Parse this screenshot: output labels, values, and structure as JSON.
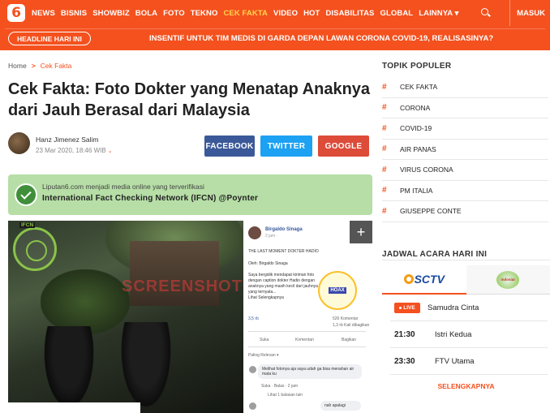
{
  "nav": {
    "logo": "6",
    "links": [
      "NEWS",
      "BISNIS",
      "SHOWBIZ",
      "BOLA",
      "FOTO",
      "TEKNO",
      "CEK FAKTA",
      "VIDEO",
      "HOT",
      "DISABILITAS",
      "GLOBAL",
      "LAINNYA ▾"
    ],
    "active_index": 6,
    "login": "MASUK"
  },
  "headline": {
    "badge": "HEADLINE HARI INI",
    "text": "INSENTIF UNTUK TIM MEDIS DI GARDA DEPAN LAWAN CORONA COVID-19, REALISASINYA?"
  },
  "breadcrumb": {
    "home": "Home",
    "separator": ">",
    "category": "Cek Fakta"
  },
  "article": {
    "title": "Cek Fakta: Foto Dokter yang Menatap Anaknya dari Jauh Berasal dari Malaysia",
    "author": "Hanz Jimenez Salim",
    "date": "23 Mar 2020, 18:46 WIB"
  },
  "share": {
    "facebook": "FACEBOOK",
    "twitter": "TWITTER",
    "google": "GOOGLE"
  },
  "factcheck": {
    "line1": "Liputan6.com menjadi media online yang terverifikasi",
    "line2": "International Fact Checking Network (IFCN) @Poynter"
  },
  "photo": {
    "ifcn_label": "IFCN",
    "watermark": "SCREENSHOT",
    "post": {
      "name": "Birgaldo Sinaga",
      "time": "2 jam · ",
      "heading": "THE LAST MOMENT DOKTER HADIO",
      "byline": "Oleh: Birgaldo Sinaga",
      "body": "Saya bergidik mendapat kiriman foto dengan caption dokter Hadio dengan anaknya yang masih kecil dari jauhnya yang ternyata...",
      "more": "Lihat Selengkapnya",
      "hoax_stamp": "HOAX",
      "reactions": "3,5 rb",
      "comments_count": "526 Komentar",
      "shares_count": "1,3 rb Kali dibagikan",
      "actions": [
        "Suka",
        "Komentari",
        "Bagikan"
      ],
      "relevance": "Paling Relevan ▾",
      "comment1": "Melihat fotonya aja saya udah ga bisa menahan air mata ku",
      "comment1_meta": "Suka · Balas · 2 jam",
      "replies": "Lihat 1 balasan lain",
      "comment2": "nah apalagi"
    }
  },
  "sidebar": {
    "topics_heading": "TOPIK POPULER",
    "topics": [
      "CEK FAKTA",
      "CORONA",
      "COVID-19",
      "AIR PANAS",
      "VIRUS CORONA",
      "PM ITALIA",
      "GIUSEPPE CONTE"
    ],
    "schedule_heading": "JADWAL ACARA HARI INI",
    "channels": [
      "SCTV",
      "indosiar"
    ],
    "schedule": [
      {
        "time": "LIVE",
        "program": "Samudra Cinta"
      },
      {
        "time": "21:30",
        "program": "Istri Kedua"
      },
      {
        "time": "23:30",
        "program": "FTV Utama"
      }
    ],
    "more": "SELENGKAPNYA"
  },
  "colors": {
    "brand": "#f4511e",
    "facebook": "#3b5998",
    "twitter": "#1da1f2",
    "google": "#dd4b39",
    "factbox": "#b6dea6"
  }
}
